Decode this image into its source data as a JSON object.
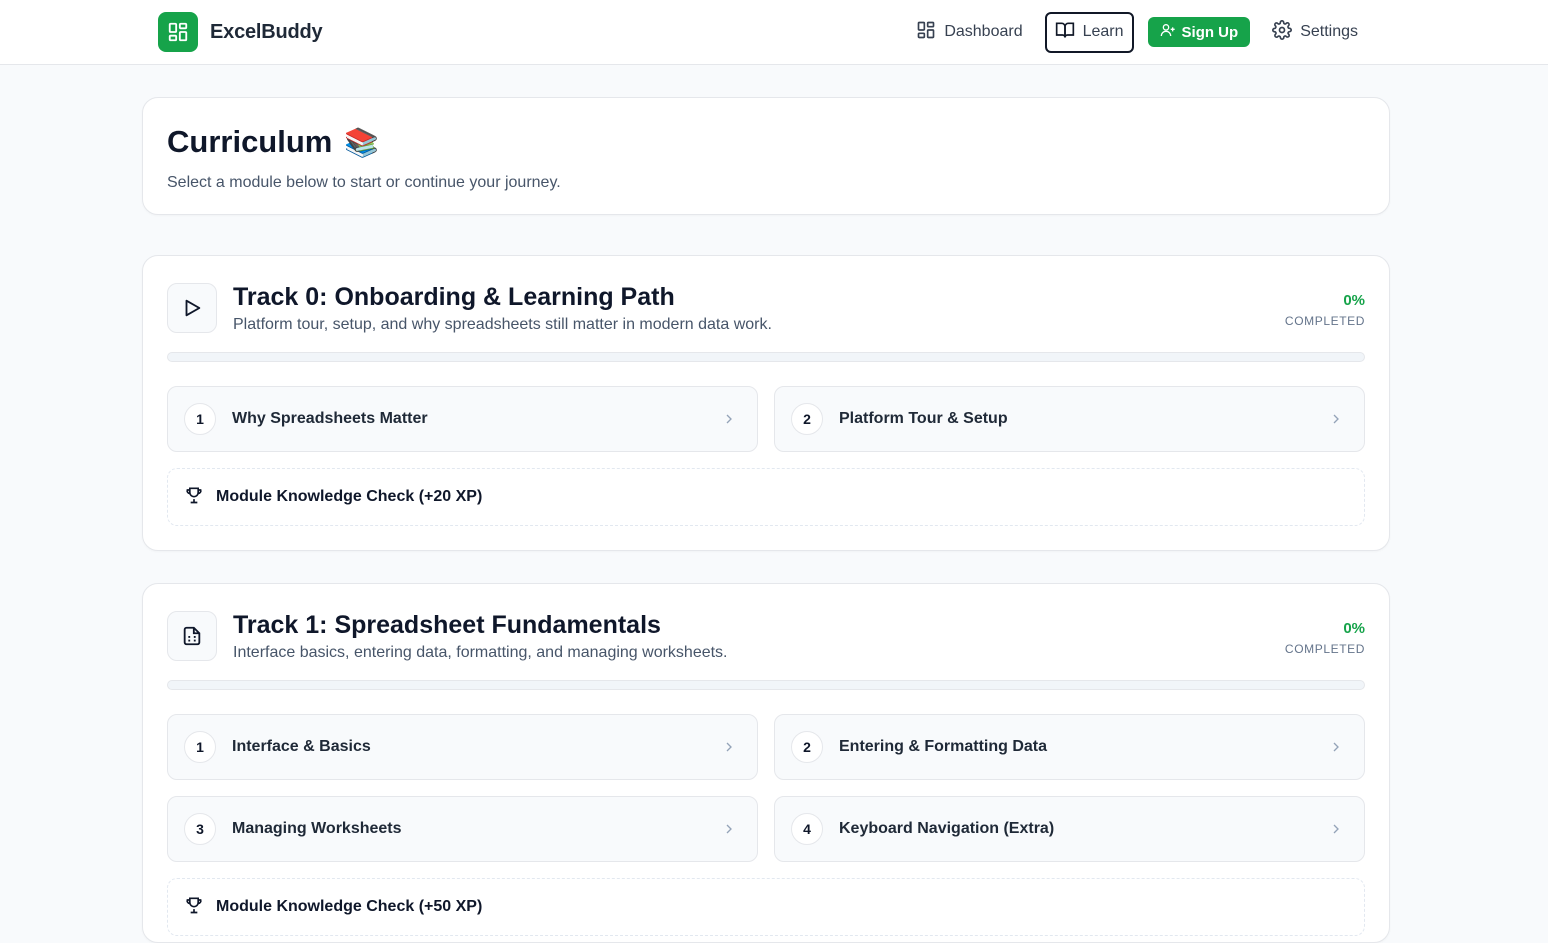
{
  "header": {
    "brand": "ExcelBuddy",
    "nav": {
      "dashboard": "Dashboard",
      "learn": "Learn",
      "signup": "Sign Up",
      "settings": "Settings"
    }
  },
  "intro": {
    "title": "Curriculum",
    "emoji": "📚",
    "subtitle": "Select a module below to start or continue your journey."
  },
  "tracks": [
    {
      "icon": "play-icon",
      "title": "Track 0: Onboarding & Learning Path",
      "description": "Platform tour, setup, and why spreadsheets still matter in modern data work.",
      "progress_pct": "0%",
      "progress_value": 0,
      "progress_label": "COMPLETED",
      "lessons": [
        {
          "num": "1",
          "title": "Why Spreadsheets Matter"
        },
        {
          "num": "2",
          "title": "Platform Tour & Setup"
        }
      ],
      "check_label": "Module Knowledge Check (+20 XP)"
    },
    {
      "icon": "document-icon",
      "title": "Track 1: Spreadsheet Fundamentals",
      "description": "Interface basics, entering data, formatting, and managing worksheets.",
      "progress_pct": "0%",
      "progress_value": 0,
      "progress_label": "COMPLETED",
      "lessons": [
        {
          "num": "1",
          "title": "Interface & Basics"
        },
        {
          "num": "2",
          "title": "Entering & Formatting Data"
        },
        {
          "num": "3",
          "title": "Managing Worksheets"
        },
        {
          "num": "4",
          "title": "Keyboard Navigation (Extra)"
        }
      ],
      "check_label": "Module Knowledge Check (+50 XP)"
    }
  ],
  "colors": {
    "accent": "#16a34a",
    "text": "#0f172a",
    "muted": "#475569",
    "border": "#e5e7eb"
  }
}
